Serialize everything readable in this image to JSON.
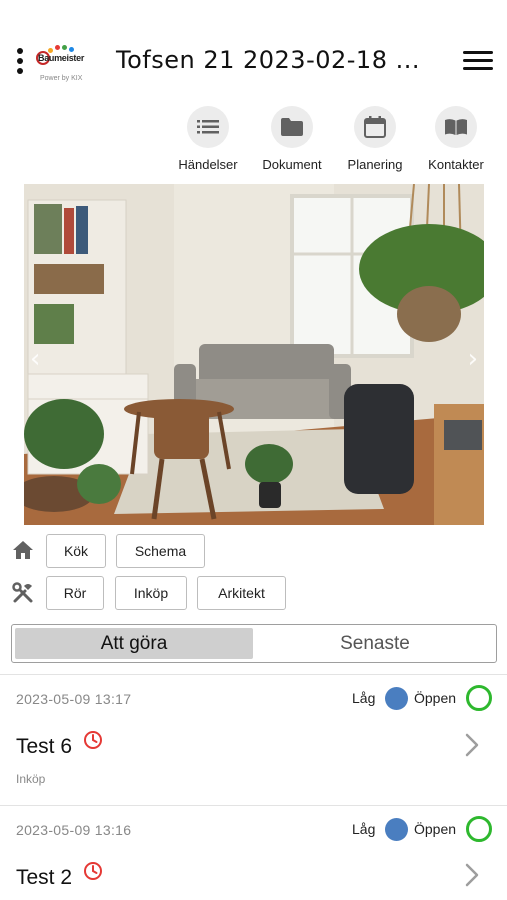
{
  "header": {
    "title": "Tofsen 21 2023-02-18 ...",
    "logo_text": "Baumeister",
    "logo_sub": "Power by KIX"
  },
  "quicknav": [
    {
      "label": "Händelser",
      "icon": "list-icon"
    },
    {
      "label": "Dokument",
      "icon": "folder-icon"
    },
    {
      "label": "Planering",
      "icon": "calendar-icon"
    },
    {
      "label": "Kontakter",
      "icon": "book-icon"
    }
  ],
  "rooms": {
    "icon": "home-icon",
    "items": [
      "Kök",
      "Schema"
    ]
  },
  "trades": {
    "icon": "tools-icon",
    "items": [
      "Rör",
      "Inköp",
      "Arkitekt"
    ]
  },
  "tabs": {
    "active": "Att göra",
    "inactive": "Senaste"
  },
  "tasks": [
    {
      "date": "2023-05-09 13:17",
      "priority": "Låg",
      "state": "Öppen",
      "title": "Test 6",
      "category": "Inköp"
    },
    {
      "date": "2023-05-09 13:16",
      "priority": "Låg",
      "state": "Öppen",
      "title": "Test 2",
      "category": ""
    }
  ],
  "colors": {
    "priority_low": "#4a7ec0",
    "state_open": "#2eb82e",
    "overdue": "#e53935",
    "segment_active": "#cfcfcf"
  }
}
